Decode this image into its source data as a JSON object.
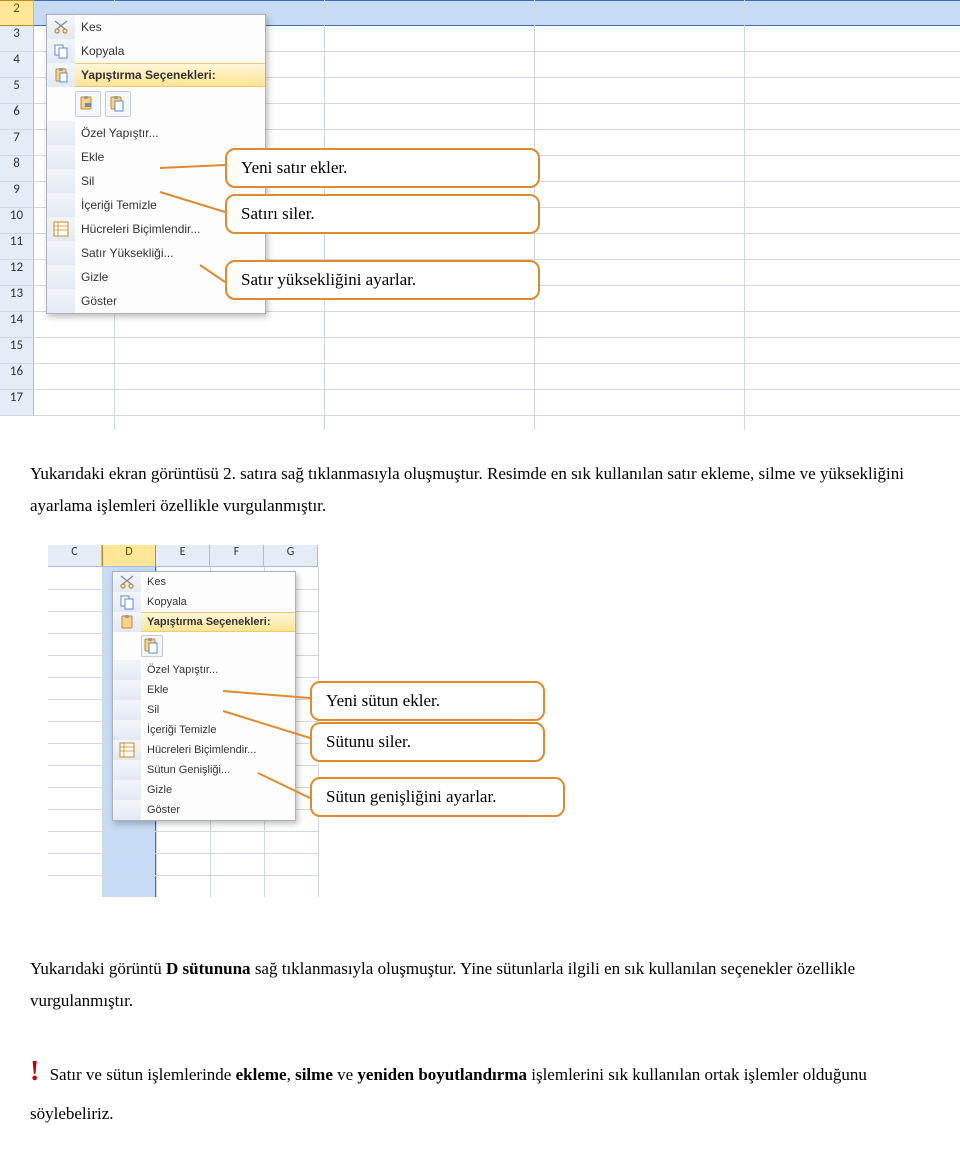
{
  "figure1": {
    "row_numbers": [
      "2",
      "3",
      "4",
      "5",
      "6",
      "7",
      "8",
      "9",
      "10",
      "11",
      "12",
      "13",
      "14",
      "15",
      "16",
      "17"
    ],
    "selected_row_index": 0,
    "menu": {
      "kes": "Kes",
      "kopyala": "Kopyala",
      "paste_header": "Yapıştırma Seçenekleri:",
      "ozel": "Özel Yapıştır...",
      "ekle": "Ekle",
      "sil": "Sil",
      "temizle": "İçeriği Temizle",
      "bicimlendir": "Hücreleri Biçimlendir...",
      "boyut": "Satır Yüksekliği...",
      "gizle": "Gizle",
      "goster": "Göster"
    },
    "callouts": {
      "ekle": "Yeni satır ekler.",
      "sil": "Satırı siler.",
      "boyut": "Satır yüksekliğini ayarlar."
    }
  },
  "paragraph1": "Yukarıdaki ekran görüntüsü 2. satıra sağ tıklanmasıyla oluşmuştur. Resimde en sık kullanılan satır ekleme, silme ve yüksekliğini ayarlama işlemleri özellikle vurgulanmıştır.",
  "figure2": {
    "columns": [
      "C",
      "D",
      "E",
      "F",
      "G"
    ],
    "selected_column_index": 1,
    "menu": {
      "kes": "Kes",
      "kopyala": "Kopyala",
      "paste_header": "Yapıştırma Seçenekleri:",
      "ozel": "Özel Yapıştır...",
      "ekle": "Ekle",
      "sil": "Sil",
      "temizle": "İçeriği Temizle",
      "bicimlendir": "Hücreleri Biçimlendir...",
      "boyut": "Sütun Genişliği...",
      "gizle": "Gizle",
      "goster": "Göster"
    },
    "callouts": {
      "ekle": "Yeni sütun ekler.",
      "sil": "Sütunu siler.",
      "boyut": "Sütun genişliğini ayarlar."
    }
  },
  "paragraph2_pre": "Yukarıdaki görüntü ",
  "paragraph2_bold": "D sütununa",
  "paragraph2_post": " sağ tıklanmasıyla oluşmuştur. Yine sütunlarla ilgili en sık kullanılan seçenekler özellikle vurgulanmıştır.",
  "paragraph3_exclaim": "!",
  "paragraph3_pre": " Satır ve sütun işlemlerinde ",
  "paragraph3_b1": "ekleme",
  "paragraph3_m1": ", ",
  "paragraph3_b2": "silme",
  "paragraph3_m2": " ve ",
  "paragraph3_b3": "yeniden boyutlandırma",
  "paragraph3_post": " işlemlerini sık kullanılan ortak işlemler olduğunu söylebeliriz."
}
